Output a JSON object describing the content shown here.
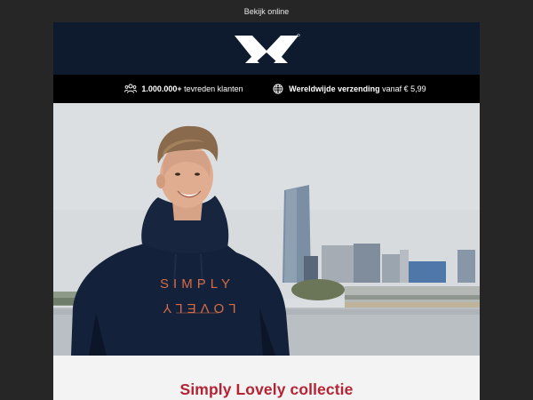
{
  "topbar": {
    "view_online": "Bekijk online"
  },
  "header": {
    "logo_icon": "brand-logo-icon",
    "logo_color": "#ffffff",
    "background": "#0e1b2e"
  },
  "usp_bar": {
    "items": [
      {
        "icon": "people-icon",
        "bold": "1.000.000+",
        "text": " tevreden klanten"
      },
      {
        "icon": "globe-icon",
        "bold": "Wereldwijde verzending",
        "text": " vanaf € 5,99"
      }
    ]
  },
  "hero": {
    "hoodie_print_line1": "SIMPLY",
    "hoodie_print_line2": "LOVELY",
    "print_color": "#d46b45"
  },
  "collection": {
    "title": "Simply Lovely collectie",
    "title_color": "#b42333"
  }
}
